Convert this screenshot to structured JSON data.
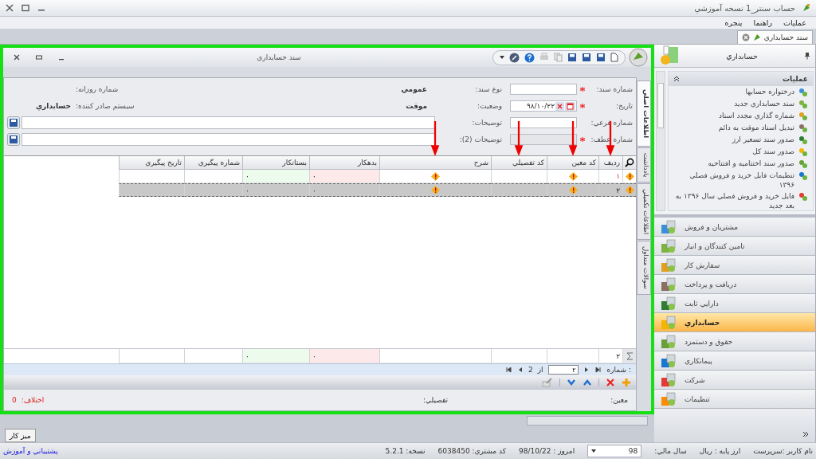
{
  "app_title": "حساب سنتر_1 نسخه آموزشي",
  "menu": [
    "عمليات",
    "راهنما",
    "پنجره"
  ],
  "doc_tabs": [
    {
      "label": "سند حسابداري",
      "selected": true
    }
  ],
  "document": {
    "title": "سند حسابداري",
    "side_tabs": [
      {
        "label": "اطلاعات اصلي",
        "selected": true
      },
      {
        "label": "يادداشت",
        "selected": false
      },
      {
        "label": "اطلاعات تکميلي",
        "selected": false
      },
      {
        "label": "سوالات متداول",
        "selected": false
      }
    ],
    "form": {
      "doc_number": {
        "label": "شماره سند:",
        "required": true
      },
      "date": {
        "label": "تاريخ:",
        "required": true,
        "value": "٩٨/١٠/٢٢"
      },
      "sub_number": {
        "label": "شماره فرعي:"
      },
      "ref_number": {
        "label": "شماره عطف:",
        "required": true,
        "disabled": true
      },
      "doc_type": {
        "label": "نوع سند:",
        "value": "عمومي"
      },
      "status": {
        "label": "وضعيت:",
        "value": "موقت"
      },
      "daily_number": {
        "label": "شماره روزانه:"
      },
      "issuer": {
        "label": "سيستم صادر کننده:",
        "value": "حسابداري"
      },
      "notes": {
        "label": "توضيحات:"
      },
      "notes2": {
        "label": "توضيحات (2):"
      }
    },
    "grid": {
      "columns": [
        {
          "label": "رديف",
          "arrow": true
        },
        {
          "label": "کد معين",
          "arrow": true
        },
        {
          "label": "کد تفصيلي",
          "arrow": true
        },
        {
          "label": "شرح",
          "arrow": true
        },
        {
          "label": "بدهکار",
          "arrow": false
        },
        {
          "label": "بستانکار",
          "arrow": false
        },
        {
          "label": "شماره پيگيري",
          "arrow": false
        },
        {
          "label": "تاريخ پيگيري",
          "arrow": false
        }
      ],
      "rows": [
        {
          "selected": false,
          "warning": true,
          "number": "١",
          "account_warning": true,
          "description_warning": true,
          "debit": "٠",
          "credit": "٠"
        },
        {
          "selected": true,
          "warning": true,
          "number": "٢",
          "account_warning": true,
          "description_warning": true,
          "debit": "٠",
          "credit": "٠"
        }
      ],
      "totals": {
        "count": "٢",
        "debit": "٠",
        "credit": "٠"
      }
    },
    "pager": {
      "label": ": شماره",
      "value": "٢",
      "of": "از",
      "total": "2"
    },
    "summary": {
      "account": "معين:",
      "detail": "تفصيلي:",
      "difference_label": "اختلاف:",
      "difference_value": "0"
    }
  },
  "sidebar": {
    "title": "حسابداري",
    "group_title": "عمليات",
    "operations": [
      "درختواره حسابها",
      "سند حسابداري جديد",
      "شماره گذاري مجدد اسناد",
      "تبديل اسناد موقت به دائم",
      "صدور سند تسعير ارز",
      "صدور سند کل",
      "صدور سند اختتاميه و افتتاحيه",
      "تنظيمات فايل خريد و فروش فصلي ۱۳۹۶",
      "فايل خريد و فروش فصلي سال ۱۳۹۶ به بعد جديد"
    ],
    "modules": [
      {
        "label": "مشتريان و فروش",
        "selected": false
      },
      {
        "label": "تامين کنندگان و انبار",
        "selected": false
      },
      {
        "label": "سفارش کار",
        "selected": false
      },
      {
        "label": "دريافت و پرداخت",
        "selected": false
      },
      {
        "label": "دارايي ثابت",
        "selected": false
      },
      {
        "label": "حسابداري",
        "selected": true
      },
      {
        "label": "حقوق و دستمزد",
        "selected": false
      },
      {
        "label": "پيمانکاري",
        "selected": false
      },
      {
        "label": "شرکت",
        "selected": false
      },
      {
        "label": "تنظيمات",
        "selected": false
      }
    ]
  },
  "desktop_button": "ميز کار",
  "status_bar": {
    "user": "نام کاربر :سرپرست",
    "currency": "ارز پايه : ريال",
    "year_label": "سال مالي:",
    "year": "98",
    "today": "امروز : 98/10/22",
    "customer": "کد مشتري: 6038450",
    "version": "نسخه: 5.2.1",
    "support": "پشتيباني و آموزش"
  }
}
